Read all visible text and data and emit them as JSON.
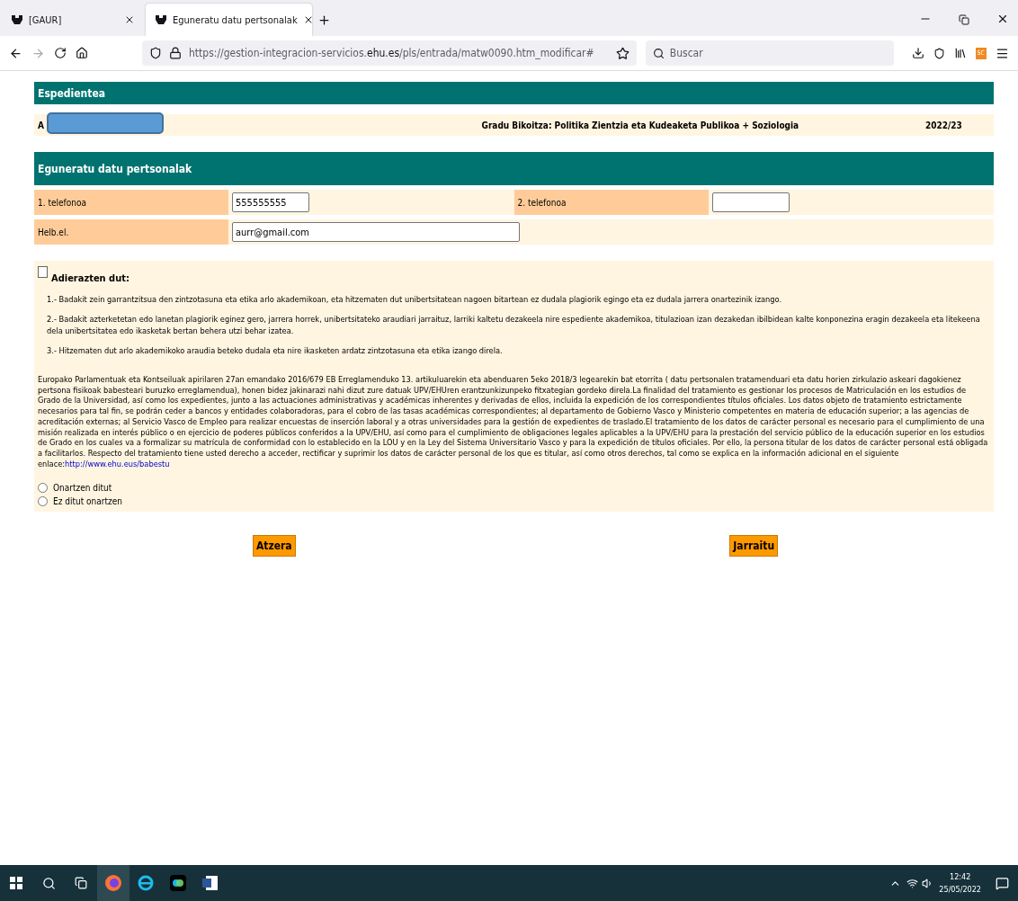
{
  "browser": {
    "tabs": [
      {
        "title": "[GAUR]",
        "selected": false
      },
      {
        "title": "Eguneratu datu pertsonalak",
        "selected": true
      }
    ],
    "url": "https://gestion-integracion-servicios.**ehu.es**/pls/entrada/matw0090.htm_modificar#",
    "search": {
      "placeholder": "Buscar"
    },
    "extension_badge": "SC"
  },
  "expedient": {
    "title": "Espedientea",
    "row": {
      "student": "A",
      "degree": "Gradu Bikoitza: Politika Zientzia eta Kudeaketa Publikoa + Soziologia",
      "year": "2022/23"
    }
  },
  "form": {
    "title": "Eguneratu datu pertsonalak",
    "rows": [
      [
        {
          "label": "1. telefonoa",
          "value": "555555555",
          "kind": "short"
        },
        {
          "label": "2. telefonoa",
          "kind": "short"
        }
      ],
      [
        {
          "label": "Helb.el.",
          "value": "aurr@gmail.com",
          "kind": "long"
        }
      ]
    ]
  },
  "declaration": {
    "checked": false,
    "title": "Adierazten dut:",
    "items": [
      "1.- Badakit zein garrantzitsua den zintzotasuna eta etika arlo akademikoan, eta hitzematen dut unibertsitatean nagoen bitartean ez dudala plagiorik egingo eta ez dudala jarrera onartezinik izango.",
      "2.- Badakit azterketetan edo lanetan plagiorik eginez gero, jarrera horrek, unibertsitateko araudiari jarraituz, larriki kaltetu dezakeela nire espediente akademikoa, titulazioan izan dezakedan ibilbidean kalte konponezina eragin dezakeela eta litekeena dela unibertsitatea edo ikasketak bertan behera utzi behar izatea.",
      "3.- Hitzematen dut arlo akademikoko araudia beteko dudala eta nire ikasketen ardatz zintzotasuna eta etika izango direla."
    ],
    "legal": "Europako Parlamentuak eta Kontseiluak apirilaren 27an emandako 2016/679 EB Erreglamenduko 13. artikuluarekin eta abenduaren 5eko 2018/3 legearekin bat etorrita ( datu pertsonalen tratamenduari eta datu horien zirkulazio askeari dagokienez pertsona fisikoak babesteari buruzko erreglamendua), honen bidez jakinarazi nahi dizut zure datuak UPV/EHUren erantzunkizunpeko fitxategian gordeko direla.La finalidad del tratamiento es gestionar los procesos de Matriculación en los estudios de Grado de la Universidad, así como los expedientes, junto a las actuaciones administrativas y académicas inherentes y derivadas de ellos, incluida la expedición de los correspondientes títulos oficiales. Los datos objeto de tratamiento estrictamente necesarios para tal fin, se podrán ceder a bancos y entidades colaboradoras, para el cobro de las tasas académicas correspondientes; al departamento de Gobierno Vasco y Ministerio competentes en materia de educación superior; a las agencias de acreditación externas; al Servicio Vasco de Empleo para realizar encuestas de inserción laboral y a otras universidades para la gestión de expedientes de traslado.El tratamiento de los datos de carácter personal es necesario para el cumplimiento de una misión realizada en interés público o en ejercicio de poderes públicos conferidos a la UPV/EHU, así como para el cumplimiento de obligaciones legales aplicables a la UPV/EHU para la prestación del servicio público de la educación superior en los estudios de Grado en los cuales va a formalizar su matrícula de conformidad con lo establecido en la LOU y en la Ley del Sistema Universitario Vasco y para la expedición de títulos oficiales. Por ello, la persona titular de los datos de carácter personal está obligada a facilitarlos. Respecto del tratamiento tiene usted derecho a acceder, rectificar y suprimir los datos de carácter personal de los que es titular, así como otros derechos, tal como se explica en la información adicional en el siguiente enlace:",
    "link": "http://www.ehu.eus/babestu",
    "options": [
      {
        "label": "Onartzen ditut",
        "selected": false
      },
      {
        "label": "Ez ditut onartzen",
        "selected": false
      }
    ]
  },
  "buttons": [
    "Atzera",
    "Jarraitu"
  ],
  "taskbar": {
    "time": "12:42",
    "date": "25/05/2022"
  }
}
